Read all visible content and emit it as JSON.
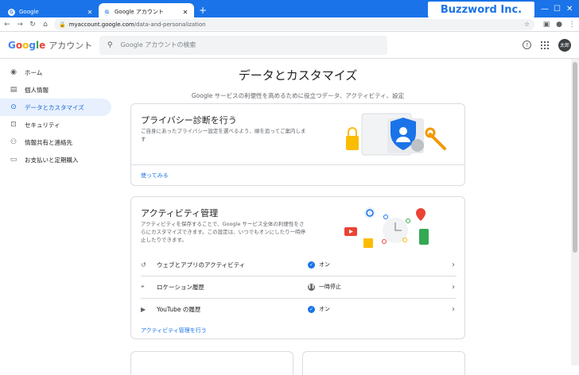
{
  "browser": {
    "tabs": [
      {
        "title": "Google",
        "active": false
      },
      {
        "title": "Google アカウント",
        "active": true
      }
    ],
    "brand": "Buzzword Inc.",
    "url": {
      "domain": "myaccount.google.com",
      "path": "/data-and-personalization"
    }
  },
  "header": {
    "logo_google": "Google",
    "logo_account": "アカウント",
    "search_placeholder": "Google アカウントの検索",
    "avatar_text": "太郎"
  },
  "sidebar": {
    "items": [
      {
        "label": "ホーム",
        "icon": "home-icon",
        "active": false
      },
      {
        "label": "個人情報",
        "icon": "id-card-icon",
        "active": false
      },
      {
        "label": "データとカスタマイズ",
        "icon": "toggle-icon",
        "active": true
      },
      {
        "label": "セキュリティ",
        "icon": "lock-icon",
        "active": false
      },
      {
        "label": "情報共有と連絡先",
        "icon": "people-icon",
        "active": false
      },
      {
        "label": "お支払いと定期購入",
        "icon": "credit-card-icon",
        "active": false
      }
    ]
  },
  "main": {
    "title": "データとカスタマイズ",
    "subtitle": "Google サービスの利便性を高めるために役立つデータ、アクティビティ、設定",
    "privacy": {
      "title": "プライバシー診断を行う",
      "desc_line1": "ご自身にあったプライバシー設定を選べるよう、順を追ってご案内しま",
      "desc_line2": "す",
      "link": "使ってみる"
    },
    "activity": {
      "title": "アクティビティ管理",
      "desc_line1": "アクティビティを保存することで、Google サービス全体の利便性をさ",
      "desc_line2": "らにカスタマイズできます。この設定は、いつでもオンにしたり一時停",
      "desc_line3": "止したりできます。",
      "rows": [
        {
          "label": "ウェブとアプリのアクティビティ",
          "status": "オン"
        },
        {
          "label": "ロケーション履歴",
          "status": "一時停止"
        },
        {
          "label": "YouTube の履歴",
          "status": "オン"
        }
      ],
      "link": "アクティビティ管理を行う"
    }
  },
  "colors": {
    "accent": "#1a73e8",
    "tabstrip": "#1a73e8",
    "nav_active_bg": "#e8f0fe"
  }
}
